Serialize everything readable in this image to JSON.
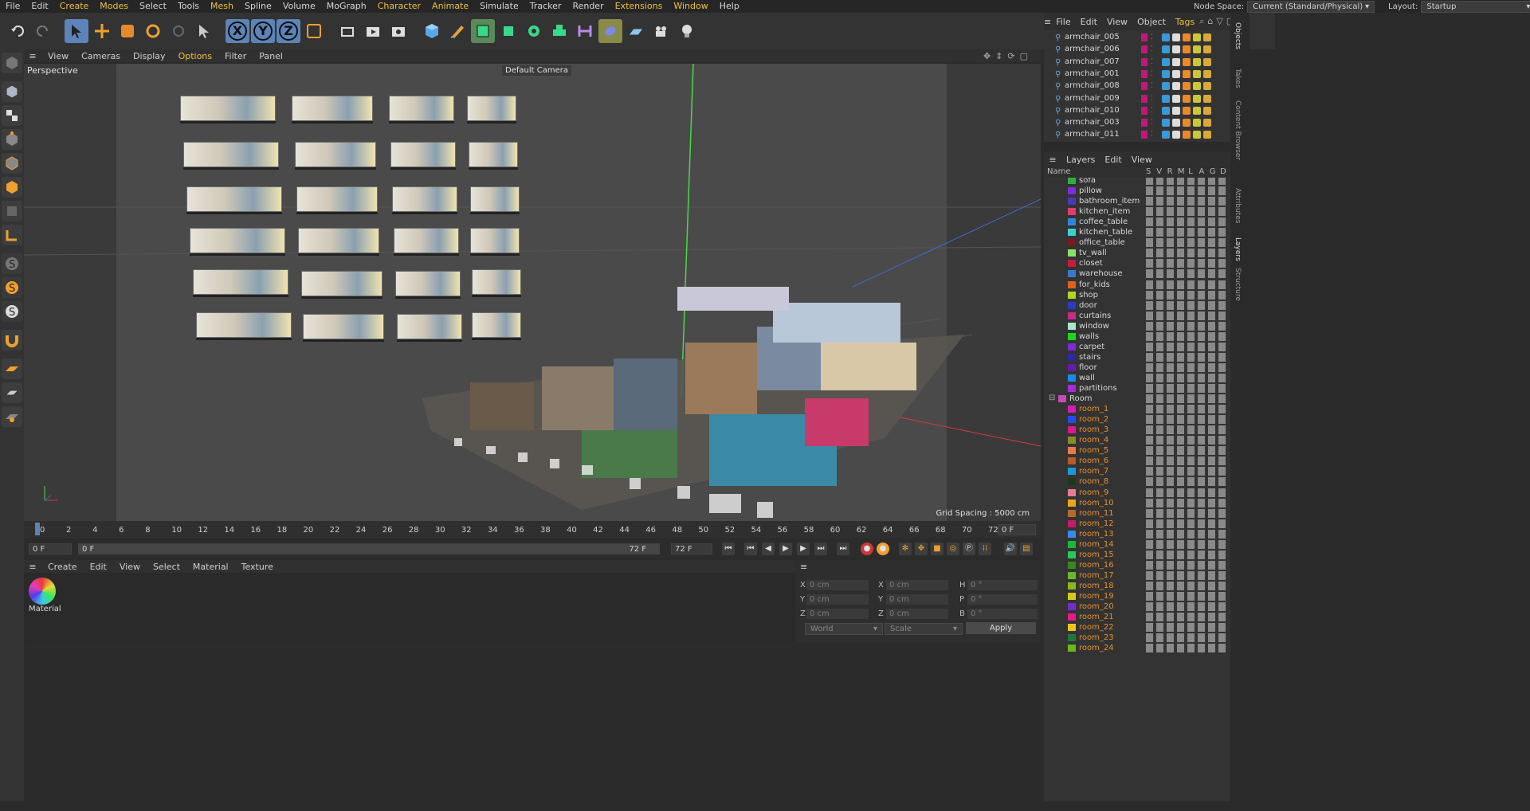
{
  "menubar": {
    "items": [
      "File",
      "Edit",
      "Create",
      "Modes",
      "Select",
      "Tools",
      "Mesh",
      "Spline",
      "Volume",
      "MoGraph",
      "Character",
      "Animate",
      "Simulate",
      "Tracker",
      "Render",
      "Extensions",
      "Window",
      "Help"
    ],
    "node_space_label": "Node Space:",
    "node_space_value": "Current (Standard/Physical)",
    "layout_label": "Layout:",
    "layout_value": "Startup"
  },
  "toolbar": {
    "axis_labels": [
      "X",
      "Y",
      "Z"
    ]
  },
  "viewport": {
    "menu": [
      "View",
      "Cameras",
      "Display",
      "Options",
      "Filter",
      "Panel"
    ],
    "projection": "Perspective",
    "camera": "Default Camera",
    "grid_spacing": "Grid Spacing : 5000 cm"
  },
  "timeline": {
    "ticks": [
      "0",
      "2",
      "4",
      "6",
      "8",
      "10",
      "12",
      "14",
      "16",
      "18",
      "20",
      "22",
      "24",
      "26",
      "28",
      "30",
      "32",
      "34",
      "36",
      "38",
      "40",
      "42",
      "44",
      "46",
      "48",
      "50",
      "52",
      "54",
      "56",
      "58",
      "60",
      "62",
      "64",
      "66",
      "68",
      "70",
      "72"
    ],
    "current_frame": "0 F",
    "start_frame": "0 F",
    "range_start": "0 F",
    "range_end": "72 F",
    "end_frame": "72 F"
  },
  "material_panel": {
    "menu": [
      "Create",
      "Edit",
      "View",
      "Select",
      "Material",
      "Texture"
    ],
    "materials": [
      {
        "name": "Material"
      }
    ]
  },
  "coords": {
    "labels_left": [
      "X",
      "Y",
      "Z"
    ],
    "labels_mid": [
      "X",
      "Y",
      "Z"
    ],
    "labels_right": [
      "H",
      "P",
      "B"
    ],
    "pos": [
      "0 cm",
      "0 cm",
      "0 cm"
    ],
    "size": [
      "0 cm",
      "0 cm",
      "0 cm"
    ],
    "rot": [
      "0 °",
      "0 °",
      "0 °"
    ],
    "mode": "World",
    "scale": "Scale",
    "apply": "Apply"
  },
  "objects": {
    "menu": [
      "File",
      "Edit",
      "View",
      "Object",
      "Tags"
    ],
    "items": [
      "armchair_005",
      "armchair_006",
      "armchair_007",
      "armchair_001",
      "armchair_008",
      "armchair_009",
      "armchair_010",
      "armchair_003",
      "armchair_011"
    ]
  },
  "layers": {
    "menu": [
      "Layers",
      "Edit",
      "View"
    ],
    "columns": [
      "Name",
      "S",
      "V",
      "R",
      "M",
      "L",
      "A",
      "G",
      "D"
    ],
    "items": [
      {
        "name": "sofa",
        "color": "#2fae3f"
      },
      {
        "name": "pillow",
        "color": "#7a2fd8"
      },
      {
        "name": "bathroom_item",
        "color": "#4a3ab0"
      },
      {
        "name": "kitchen_item",
        "color": "#e23b6e"
      },
      {
        "name": "coffee_table",
        "color": "#2f86d8"
      },
      {
        "name": "kitchen_table",
        "color": "#3ccfcf"
      },
      {
        "name": "office_table",
        "color": "#7a1a1a"
      },
      {
        "name": "tv_wall",
        "color": "#8be06a"
      },
      {
        "name": "closet",
        "color": "#c81a3a"
      },
      {
        "name": "warehouse",
        "color": "#3a78c8"
      },
      {
        "name": "for_kids",
        "color": "#e0601e"
      },
      {
        "name": "shop",
        "color": "#a8d82a"
      },
      {
        "name": "door",
        "color": "#2a3ac8"
      },
      {
        "name": "curtains",
        "color": "#c82a8a"
      },
      {
        "name": "window",
        "color": "#a8e8c8"
      },
      {
        "name": "walls",
        "color": "#1ad81a"
      },
      {
        "name": "carpet",
        "color": "#7a2ad8"
      },
      {
        "name": "stairs",
        "color": "#2a2aa8"
      },
      {
        "name": "floor",
        "color": "#6a1aa8"
      },
      {
        "name": "wall",
        "color": "#1a8ae8"
      },
      {
        "name": "partitions",
        "color": "#a82ad8"
      }
    ],
    "group": {
      "name": "Room",
      "color": "#c84ab8"
    },
    "rooms": [
      {
        "name": "room_1",
        "color": "#d81ab8"
      },
      {
        "name": "room_2",
        "color": "#2a4ae8"
      },
      {
        "name": "room_3",
        "color": "#d81a8a"
      },
      {
        "name": "room_4",
        "color": "#8a8a2a"
      },
      {
        "name": "room_5",
        "color": "#e87a4a"
      },
      {
        "name": "room_6",
        "color": "#b85a2a"
      },
      {
        "name": "room_7",
        "color": "#1a9ad8"
      },
      {
        "name": "room_8",
        "color": "#1a3a1a"
      },
      {
        "name": "room_9",
        "color": "#e87a9a"
      },
      {
        "name": "room_10",
        "color": "#e8a81a"
      },
      {
        "name": "room_11",
        "color": "#b86a2a"
      },
      {
        "name": "room_12",
        "color": "#c81a6a"
      },
      {
        "name": "room_13",
        "color": "#3a8ae8"
      },
      {
        "name": "room_14",
        "color": "#1ab83a"
      },
      {
        "name": "room_15",
        "color": "#2ac85a"
      },
      {
        "name": "room_16",
        "color": "#3a8a1a"
      },
      {
        "name": "room_17",
        "color": "#6ab82a"
      },
      {
        "name": "room_18",
        "color": "#8ab81a"
      },
      {
        "name": "room_19",
        "color": "#d8c81a"
      },
      {
        "name": "room_20",
        "color": "#7a2ac8"
      },
      {
        "name": "room_21",
        "color": "#e81a8a"
      },
      {
        "name": "room_22",
        "color": "#e8c81a"
      },
      {
        "name": "room_23",
        "color": "#1a7a3a"
      },
      {
        "name": "room_24",
        "color": "#6ab81a"
      }
    ]
  },
  "side_tabs": [
    "Objects",
    "Takes",
    "Content Browser",
    "Attributes",
    "Layers",
    "Structure"
  ]
}
